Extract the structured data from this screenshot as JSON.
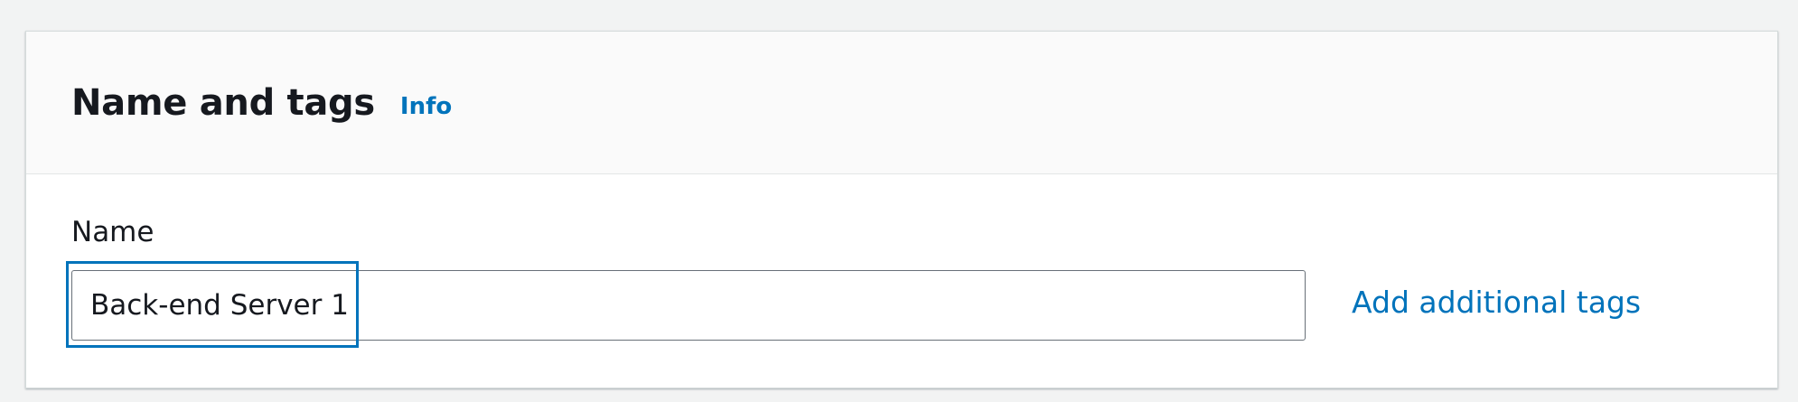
{
  "section": {
    "title": "Name and tags",
    "info_label": "Info"
  },
  "name_field": {
    "label": "Name",
    "value": "Back-end Server 1",
    "placeholder": ""
  },
  "add_tags_label": "Add additional tags",
  "colors": {
    "link": "#0073bb",
    "focus_ring": "#0073bb",
    "text": "#16191f",
    "page_background": "#f2f3f3",
    "header_background": "#fafafa"
  }
}
